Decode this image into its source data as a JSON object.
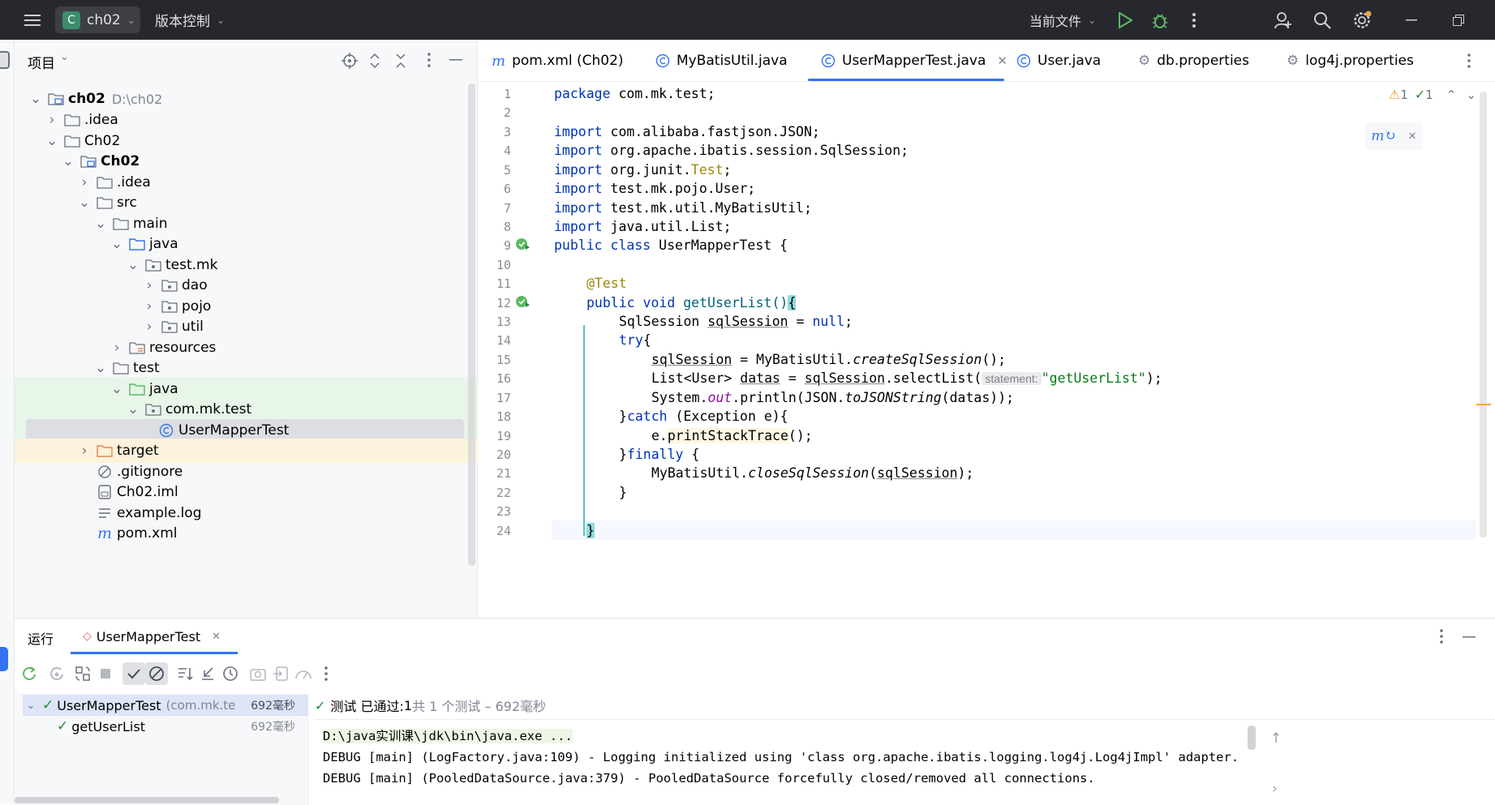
{
  "titlebar": {
    "project_badge": "C",
    "project_name": "ch02",
    "vcs_label": "版本控制",
    "run_config": "当前文件"
  },
  "project_panel": {
    "title": "项目",
    "tree": [
      {
        "label": "ch02",
        "suffix": "D:\\ch02",
        "bold": true
      },
      {
        "label": ".idea"
      },
      {
        "label": "Ch02"
      },
      {
        "label": "Ch02",
        "bold": true
      },
      {
        "label": ".idea"
      },
      {
        "label": "src"
      },
      {
        "label": "main"
      },
      {
        "label": "java"
      },
      {
        "label": "test.mk"
      },
      {
        "label": "dao"
      },
      {
        "label": "pojo"
      },
      {
        "label": "util"
      },
      {
        "label": "resources"
      },
      {
        "label": "test"
      },
      {
        "label": "java"
      },
      {
        "label": "com.mk.test"
      },
      {
        "label": "UserMapperTest"
      },
      {
        "label": "target"
      },
      {
        "label": ".gitignore"
      },
      {
        "label": "Ch02.iml"
      },
      {
        "label": "example.log"
      },
      {
        "label": "pom.xml"
      }
    ]
  },
  "editor": {
    "tabs": [
      {
        "label": "pom.xml (Ch02)"
      },
      {
        "label": "MyBatisUtil.java"
      },
      {
        "label": "UserMapperTest.java",
        "active": true
      },
      {
        "label": "User.java"
      },
      {
        "label": "db.properties"
      },
      {
        "label": "log4j.properties"
      }
    ],
    "warnings": "1",
    "checks": "1",
    "line_numbers": [
      "1",
      "2",
      "3",
      "4",
      "5",
      "6",
      "7",
      "8",
      "9",
      "10",
      "11",
      "12",
      "13",
      "14",
      "15",
      "16",
      "17",
      "18",
      "19",
      "20",
      "21",
      "22",
      "23",
      "24"
    ],
    "lines": {
      "l1a": "package",
      "l1b": " com.mk.test;",
      "l3a": "import",
      "l3b": " com.alibaba.fastjson.JSON;",
      "l4a": "import",
      "l4b": " org.apache.ibatis.session.SqlSession;",
      "l5a": "import",
      "l5b": " org.junit.",
      "l5c": "Test",
      "l5d": ";",
      "l6a": "import",
      "l6b": " test.mk.pojo.User;",
      "l7a": "import",
      "l7b": " test.mk.util.MyBatisUtil;",
      "l8a": "import",
      "l8b": " java.util.List;",
      "l9a": "public class",
      "l9b": " UserMapperTest {",
      "l11": "@Test",
      "l12a": "public void",
      "l12b": " getUserList()",
      "l12c": "{",
      "l13a": "SqlSession ",
      "l13b": "sqlSession",
      "l13c": " = ",
      "l13d": "null",
      "l13e": ";",
      "l14a": "try",
      "l14b": "{",
      "l15a": "sqlSession",
      "l15b": " = MyBatisUtil.",
      "l15c": "createSqlSession",
      "l15d": "();",
      "l16a": "List<User> ",
      "l16b": "datas",
      "l16c": " = ",
      "l16d": "sqlSession",
      "l16e": ".selectList(",
      "l16hint": "statement:",
      "l16f": "\"getUserList\"",
      "l16g": ");",
      "l17a": "System.",
      "l17b": "out",
      "l17c": ".println(JSON.",
      "l17d": "toJSONString",
      "l17e": "(datas));",
      "l18a": "}",
      "l18b": "catch",
      "l18c": " (Exception e){",
      "l19a": "e.",
      "l19b": "printStackTrace",
      "l19c": "();",
      "l20a": "}",
      "l20b": "finally",
      "l20c": " {",
      "l21a": "MyBatisUtil.",
      "l21b": "closeSqlSession",
      "l21c": "(",
      "l21d": "sqlSession",
      "l21e": ");",
      "l22": "}",
      "l24": "}"
    }
  },
  "run_panel": {
    "title": "运行",
    "tab_label": "UserMapperTest",
    "tests": [
      {
        "label": "UserMapperTest",
        "pkg": "(com.mk.te",
        "time": "692毫秒"
      },
      {
        "label": "getUserList",
        "time": "692毫秒"
      }
    ],
    "status_prefix": "测试 已通过: ",
    "status_count": "1",
    "status_suffix": "共 1 个测试 – 692毫秒",
    "console": [
      "D:\\java实训课\\jdk\\bin\\java.exe ...",
      "DEBUG [main] (LogFactory.java:109) - Logging initialized using 'class org.apache.ibatis.logging.log4j.Log4jImpl' adapter.",
      "DEBUG [main] (PooledDataSource.java:379) - PooledDataSource forcefully closed/removed all connections."
    ]
  },
  "colors": {
    "accent": "#3574f0",
    "keyword": "#0033b3",
    "annotation": "#9e880d",
    "string": "#067d17",
    "ok": "#208a3c"
  }
}
